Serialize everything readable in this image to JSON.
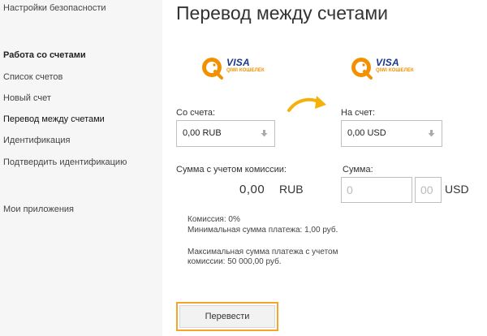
{
  "sidebar": {
    "items": [
      {
        "label": "Настройки безопасности"
      },
      {
        "label": "Работа со счетами"
      },
      {
        "label": "Список счетов"
      },
      {
        "label": "Новый счет"
      },
      {
        "label": "Перевод между счетами"
      },
      {
        "label": "Идентификация"
      },
      {
        "label": "Подтвердить идентификацию"
      },
      {
        "label": "Мои приложения"
      }
    ]
  },
  "main": {
    "title": "Перевод между счетами",
    "logo": {
      "brand": "VISA",
      "subtitle": "QIWI КОШЕЛЕК"
    },
    "from": {
      "label": "Со счета:",
      "value": "0,00 RUB"
    },
    "to": {
      "label": "На счет:",
      "value": "0,00 USD"
    },
    "fee_sum": {
      "label": "Сумма с учетом комиссии:",
      "amount": "0,00",
      "currency": "RUB"
    },
    "sum": {
      "label": "Сумма:",
      "whole": "0",
      "cents": "00",
      "currency": "USD"
    },
    "info": {
      "commission": "Комиссия: 0%",
      "min": "Минимальная сумма платежа: 1,00 руб.",
      "max": "Максимальная сумма платежа с учетом комиссии: 50 000,00 руб."
    },
    "submit_label": "Перевести"
  },
  "colors": {
    "accent": "#f4a52a",
    "visa_blue": "#1a3a8f",
    "qiwi_orange": "#f29100"
  },
  "icons": [
    "qiwi-logo-icon",
    "arrow-right-icon",
    "caret-down-icon"
  ]
}
